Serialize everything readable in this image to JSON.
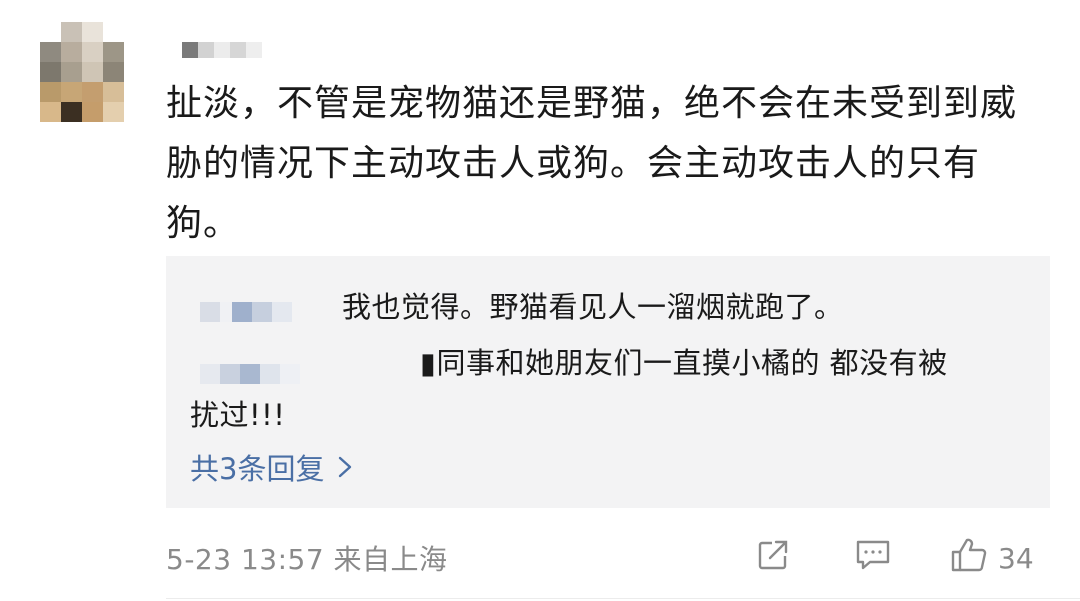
{
  "comment": {
    "lines": [
      "扯淡，不管是宠物猫还是野猫，绝不会在未受到到威",
      "胁的情况下主动攻击人或狗。会主动攻击人的只有",
      "狗。"
    ]
  },
  "replies": {
    "items": [
      {
        "text": "我也觉得。野猫看见人一溜烟就跑了。"
      },
      {
        "text": "▮同事和她朋友们一直摸小橘的 都没有被",
        "continuation": "扰过!!!"
      }
    ],
    "view_more_label": "共3条回复",
    "view_more_icon": "chevron-right-icon"
  },
  "footer": {
    "timestamp_location": "5-23 13:57 来自上海",
    "share_icon": "share-icon",
    "comment_icon": "comment-icon",
    "like_icon": "thumbs-up-icon",
    "like_count": "34"
  },
  "colors": {
    "text": "#1a1a1a",
    "muted": "#8a8a8a",
    "link": "#4a6fa5",
    "reply_bg": "#f3f3f4"
  }
}
